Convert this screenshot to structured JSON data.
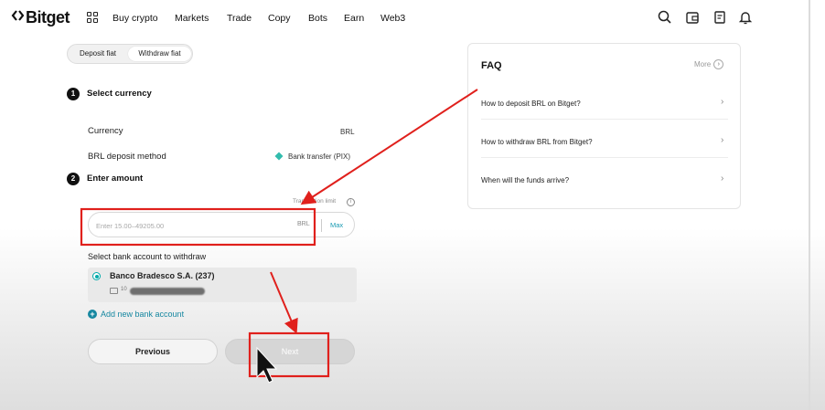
{
  "nav": {
    "brand": "Bitget",
    "items": [
      "Buy crypto",
      "Markets",
      "Trade",
      "Copy",
      "Bots",
      "Earn",
      "Web3"
    ],
    "icons": [
      "search-icon",
      "wallet-icon",
      "orders-icon",
      "bell-icon"
    ]
  },
  "tabs": {
    "deposit": "Deposit fiat",
    "withdraw": "Withdraw fiat"
  },
  "step1": {
    "num": "1",
    "title": "Select currency",
    "currency_label": "Currency",
    "currency_value": "BRL",
    "method_label": "BRL deposit method",
    "method_value": "Bank transfer (PIX)"
  },
  "step2": {
    "num": "2",
    "title": "Enter amount",
    "limit_label": "Transaction limit",
    "placeholder": "Enter 15.00–49205.00",
    "currency": "BRL",
    "max": "Max"
  },
  "bank": {
    "title": "Select bank account to withdraw",
    "account_name": "Banco Bradesco S.A. (237)",
    "account_prefix": "10",
    "add_label": "Add new bank account"
  },
  "buttons": {
    "previous": "Previous",
    "next": "Next"
  },
  "faq": {
    "title": "FAQ",
    "more": "More",
    "items": [
      "How to deposit BRL on Bitget?",
      "How to withdraw BRL from Bitget?",
      "When will the funds arrive?"
    ]
  },
  "colors": {
    "accent": "#1a9bb3",
    "annotation": "#e0201c",
    "pix": "#32bcad"
  }
}
